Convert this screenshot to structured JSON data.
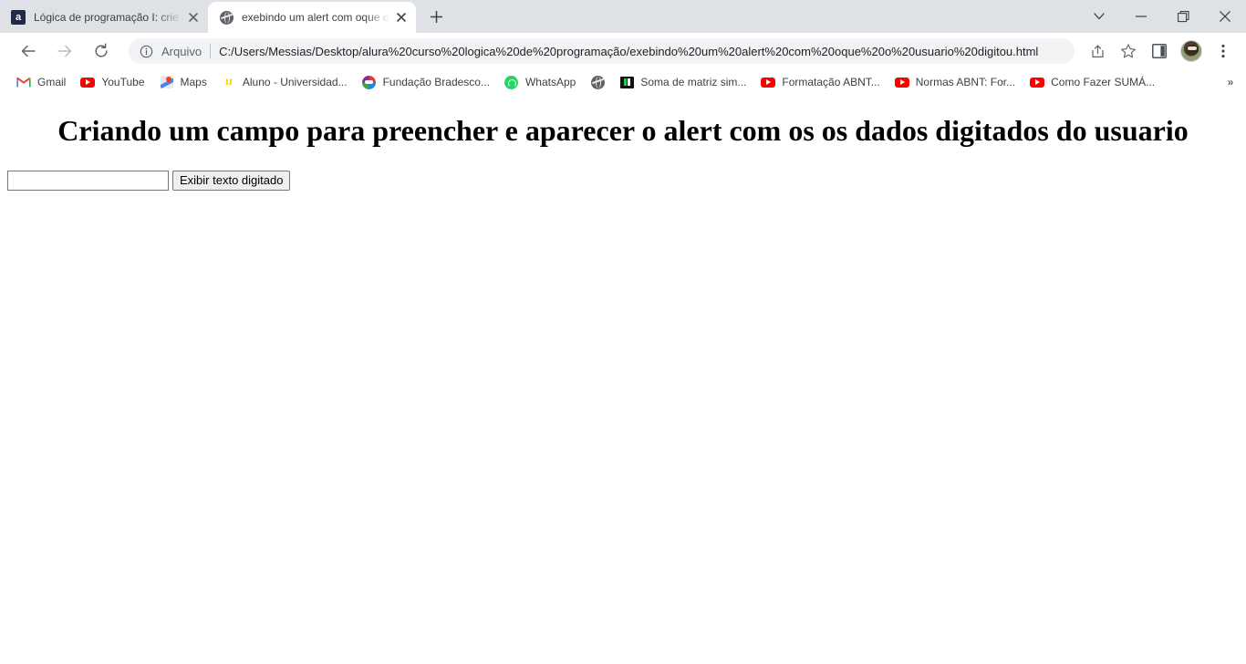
{
  "window": {
    "controls": [
      {
        "name": "tab-search-button",
        "icon": "chevron-down-icon",
        "label": "∨"
      },
      {
        "name": "minimize-button",
        "icon": "minimize-icon",
        "label": "—"
      },
      {
        "name": "maximize-button",
        "icon": "maximize-icon",
        "label": "❐"
      },
      {
        "name": "close-button",
        "icon": "close-icon",
        "label": "✕"
      }
    ]
  },
  "tabs": [
    {
      "title": "Lógica de programação I: crie pro",
      "favicon": "alura-icon",
      "favicon_letter": "a",
      "active": false
    },
    {
      "title": "exebindo um alert com oque o u",
      "favicon": "globe-icon",
      "active": true
    }
  ],
  "newtab": {
    "label": "+",
    "title": "New tab"
  },
  "toolbar": {
    "back_label": "←",
    "forward_label": "→",
    "reload_label": "↻",
    "omnibox": {
      "info_icon": "info-circle-icon",
      "scheme_label": "Arquivo",
      "url": "C:/Users/Messias/Desktop/alura%20curso%20logica%20de%20programação/exebindo%20um%20alert%20com%20oque%20o%20usuario%20digitou.html"
    },
    "actions": [
      {
        "name": "share-button",
        "icon": "share-icon"
      },
      {
        "name": "bookmark-star-button",
        "icon": "star-icon"
      },
      {
        "name": "side-panel-button",
        "icon": "side-panel-icon"
      }
    ],
    "profile": {
      "name": "profile-avatar",
      "alt": "Profile"
    },
    "menu_label": "⋮"
  },
  "bookmarks": {
    "items": [
      {
        "label": "Gmail",
        "icon": "gmail-icon"
      },
      {
        "label": "YouTube",
        "icon": "youtube-icon"
      },
      {
        "label": "Maps",
        "icon": "maps-icon"
      },
      {
        "label": "Aluno - Universidad...",
        "icon": "aluno-icon"
      },
      {
        "label": "Fundação Bradesco...",
        "icon": "bradesco-icon"
      },
      {
        "label": "WhatsApp",
        "icon": "whatsapp-icon"
      },
      {
        "label": "",
        "icon": "globe-icon"
      },
      {
        "label": "Soma de matriz sim...",
        "icon": "matriz-icon"
      },
      {
        "label": "Formatação ABNT...",
        "icon": "youtube-icon"
      },
      {
        "label": "Normas ABNT: For...",
        "icon": "youtube-icon"
      },
      {
        "label": "Como Fazer SUMÁ...",
        "icon": "youtube-icon"
      }
    ],
    "overflow_label": "»"
  },
  "page": {
    "heading": "Criando um campo para preencher e aparecer o alert com os os dados digitados do usuario",
    "input_value": "",
    "input_placeholder": "",
    "button_label": "Exibir texto digitado"
  },
  "colors": {
    "tabstrip_bg": "#dee1e6",
    "toolbar_bg": "#ffffff",
    "omnibox_bg": "#f1f3f4",
    "text": "#3c4043",
    "youtube_red": "#ff0000",
    "whatsapp_green": "#25d366",
    "alura_navy": "#1d2b48"
  }
}
